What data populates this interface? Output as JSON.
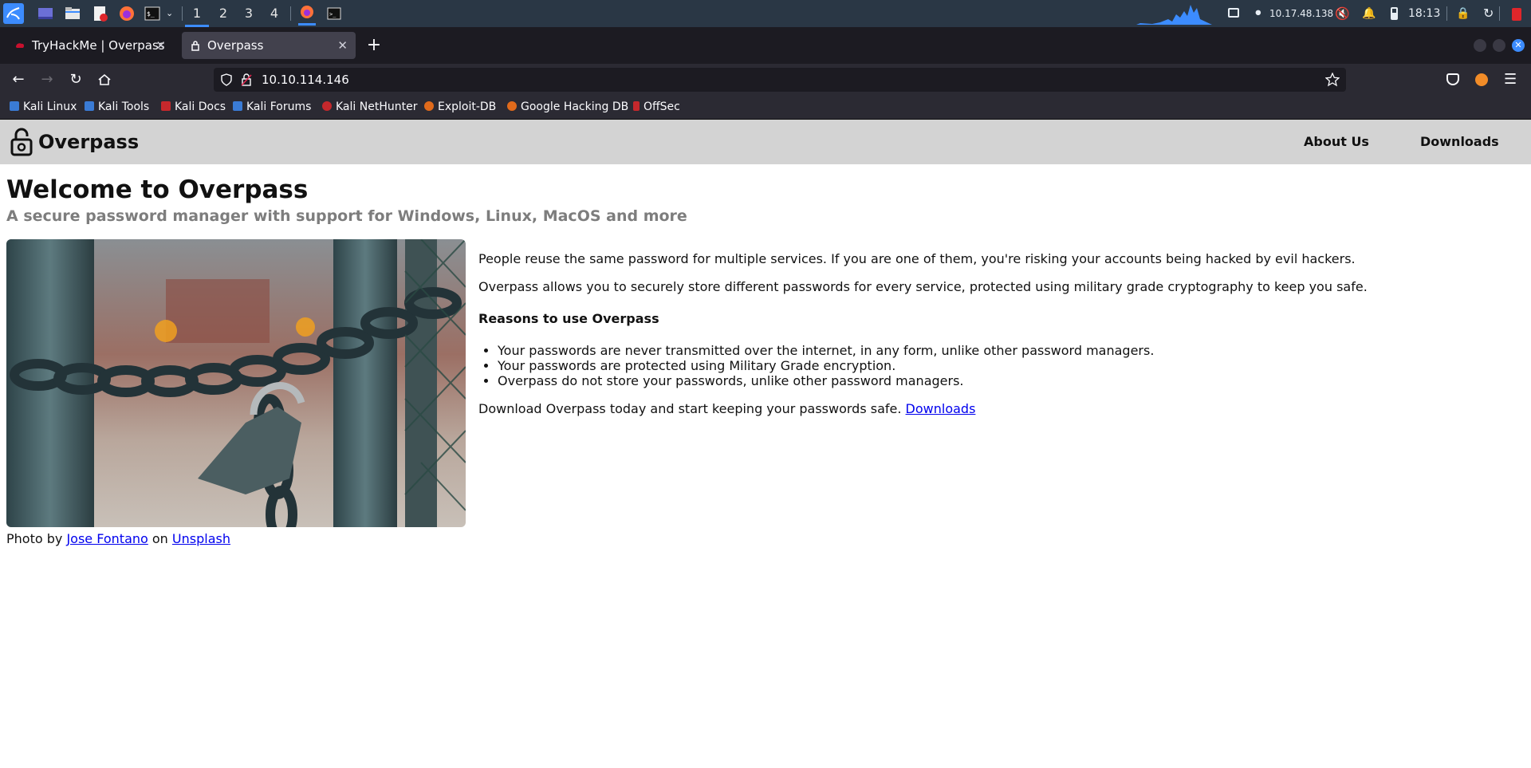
{
  "taskbar": {
    "workspaces": [
      "1",
      "2",
      "3",
      "4"
    ],
    "active_workspace": "1",
    "ip_address": "10.17.48.138",
    "clock": "18:13"
  },
  "browser": {
    "tabs": [
      {
        "title": "TryHackMe | Overpass",
        "active": false
      },
      {
        "title": "Overpass",
        "active": true
      }
    ],
    "url": "10.10.114.146",
    "bookmarks": [
      {
        "label": "Kali Linux",
        "color": "#3a7bd5"
      },
      {
        "label": "Kali Tools",
        "color": "#3a7bd5"
      },
      {
        "label": "Kali Docs",
        "color": "#c5282c"
      },
      {
        "label": "Kali Forums",
        "color": "#3a7bd5"
      },
      {
        "label": "Kali NetHunter",
        "color": "#c5282c"
      },
      {
        "label": "Exploit-DB",
        "color": "#e06a1b"
      },
      {
        "label": "Google Hacking DB",
        "color": "#e06a1b"
      },
      {
        "label": "OffSec",
        "color": "#c5282c"
      }
    ]
  },
  "site": {
    "brand": "Overpass",
    "nav": [
      "About Us",
      "Downloads"
    ],
    "title": "Welcome to Overpass",
    "subtitle": "A secure password manager with support for Windows, Linux, MacOS and more",
    "credit": {
      "prefix": "Photo by",
      "author": "Jose Fontano",
      "on": "on",
      "source": "Unsplash"
    },
    "intro1": "People reuse the same password for multiple services. If you are one of them, you're risking your accounts being hacked by evil hackers.",
    "intro2": "Overpass allows you to securely store different passwords for every service, protected using military grade cryptography to keep you safe.",
    "reasons_heading": "Reasons to use Overpass",
    "reasons": [
      "Your passwords are never transmitted over the internet, in any form, unlike other password managers.",
      "Your passwords are protected using Military Grade encryption.",
      "Overpass do not store your passwords, unlike other password managers."
    ],
    "download_text": "Download Overpass today and start keeping your passwords safe.",
    "download_link": "Downloads"
  }
}
